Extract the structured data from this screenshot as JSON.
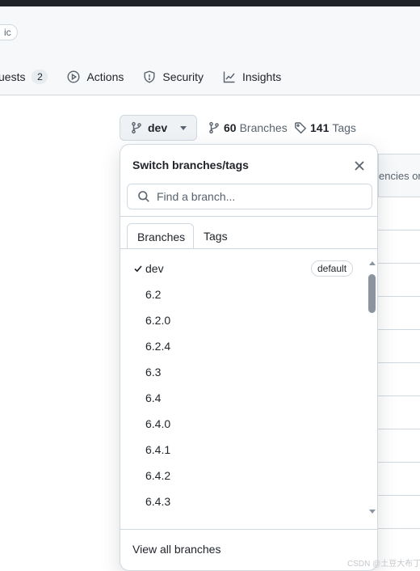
{
  "header": {
    "visibility_badge": "Public",
    "nav": [
      {
        "label": "Pull requests",
        "count": "2",
        "icon": "pull-request-icon"
      },
      {
        "label": "Actions",
        "icon": "play-icon"
      },
      {
        "label": "Security",
        "icon": "shield-icon"
      },
      {
        "label": "Insights",
        "icon": "graph-icon"
      }
    ]
  },
  "nav_visible": {
    "pulls_label": "uests",
    "visibility": "ic"
  },
  "branch_button": {
    "label": "dev",
    "icon": "git-branch-icon"
  },
  "branches_link": {
    "count": "60",
    "label": "Branches",
    "icon": "git-branch-icon"
  },
  "tags_link": {
    "count": "141",
    "label": "Tags",
    "icon": "tag-icon"
  },
  "background_table": {
    "header_text": "encies on"
  },
  "dropdown": {
    "title": "Switch branches/tags",
    "search_placeholder": "Find a branch...",
    "tabs": [
      {
        "label": "Branches",
        "active": true
      },
      {
        "label": "Tags",
        "active": false
      }
    ],
    "items": [
      {
        "name": "dev",
        "selected": true,
        "badge": "default"
      },
      {
        "name": "6.2"
      },
      {
        "name": "6.2.0"
      },
      {
        "name": "6.2.4"
      },
      {
        "name": "6.3"
      },
      {
        "name": "6.4"
      },
      {
        "name": "6.4.0"
      },
      {
        "name": "6.4.1"
      },
      {
        "name": "6.4.2"
      },
      {
        "name": "6.4.3"
      }
    ],
    "view_all": "View all branches"
  },
  "watermark": "CSDN @土豆大布丁",
  "colors": {
    "text": "#1f2328",
    "muted": "#59636e",
    "border": "#d1d9e0",
    "header_bg": "#f6f8fa",
    "button_bg": "#eff2f5"
  }
}
